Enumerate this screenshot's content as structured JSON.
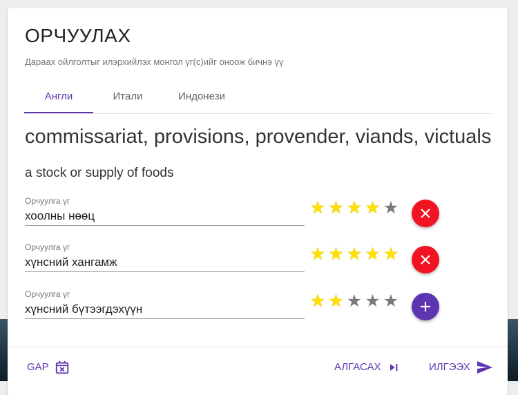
{
  "header": {
    "title": "ОРЧУУЛАХ",
    "subtitle": "Дараах ойлголтыг илэрхийлэх монгол үг(с)ийг оноож бичнэ үү"
  },
  "tabs": [
    {
      "label": "Англи",
      "active": true
    },
    {
      "label": "Итали",
      "active": false
    },
    {
      "label": "Индонези",
      "active": false
    }
  ],
  "word": "commissariat, provisions, provender, viands, victuals",
  "definition": "a stock or supply of foods",
  "translations": [
    {
      "label": "Орчуулга үг",
      "value": "хоолны нөөц",
      "rating": 4,
      "max_rating": 5,
      "action": "remove"
    },
    {
      "label": "Орчуулга үг",
      "value": "хүнсний хангамж",
      "rating": 5,
      "max_rating": 5,
      "action": "remove"
    },
    {
      "label": "Орчуулга үг",
      "value": "хүнсний бүтээгдэхүүн",
      "rating": 2,
      "max_rating": 5,
      "action": "add"
    }
  ],
  "footer": {
    "gap_label": "GAP",
    "skip_label": "АЛГАСАХ",
    "send_label": "ИЛГЭЭХ"
  },
  "colors": {
    "accent": "#5e35b1",
    "danger": "#f01322",
    "star_on": "#ffe000",
    "star_off": "#7a7a7a"
  },
  "icons": {
    "remove": "close-icon",
    "add": "plus-icon",
    "gap": "calendar-x-icon",
    "skip": "skip-next-icon",
    "send": "send-icon"
  }
}
